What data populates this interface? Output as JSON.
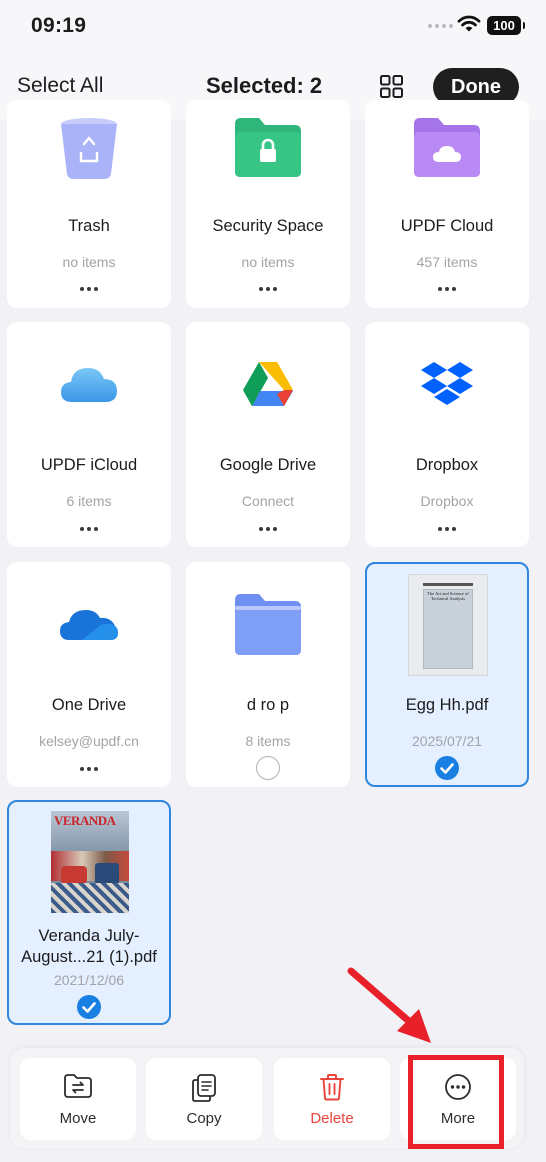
{
  "status_bar": {
    "time": "09:19",
    "battery": "100"
  },
  "nav": {
    "select_all": "Select All",
    "title": "Selected: 2",
    "done": "Done"
  },
  "tiles": [
    {
      "name": "Trash",
      "sub": "no items"
    },
    {
      "name": "Security Space",
      "sub": "no items"
    },
    {
      "name": "UPDF Cloud",
      "sub": "457 items"
    },
    {
      "name": "UPDF iCloud",
      "sub": "6 items"
    },
    {
      "name": "Google Drive",
      "sub": "Connect"
    },
    {
      "name": "Dropbox",
      "sub": "Dropbox"
    },
    {
      "name": "One Drive",
      "sub": "kelsey@updf.cn"
    },
    {
      "name": "d ro p",
      "sub": "8 items",
      "selected": false
    },
    {
      "name": "Egg Hh.pdf",
      "sub": "2025/07/21",
      "selected": true,
      "thumb_text": "The Art and Science of Technical Analysis"
    },
    {
      "name_line1": "Veranda July-",
      "name_line2": "August...21 (1).pdf",
      "sub": "2021/12/06",
      "selected": true,
      "thumb_text": "VERANDA"
    }
  ],
  "toolbar": {
    "move": "Move",
    "copy": "Copy",
    "delete": "Delete",
    "more": "More"
  },
  "colors": {
    "accent": "#1a7fe3",
    "delete": "#e8453c",
    "highlight": "#e8202a"
  }
}
